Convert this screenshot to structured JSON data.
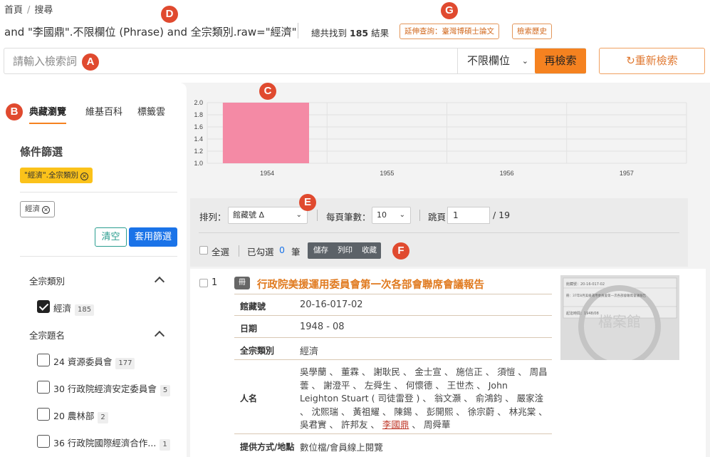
{
  "breadcrumb": {
    "home": "首頁",
    "current": "搜尋"
  },
  "query": {
    "text": "and \"李國鼎\".不限欄位 (Phrase) and 全宗類別.raw=\"經濟\"",
    "total_prefix": "總共找到",
    "total_count": "185",
    "total_suffix": "結果",
    "ext_button": "延伸查詢：臺灣博碩士論文",
    "history_button": "檢索歷史"
  },
  "search": {
    "placeholder": "請輸入檢索詞",
    "field_value": "不限欄位",
    "submit_label": "再檢索",
    "reset_label": "↻重新檢索"
  },
  "sidebar": {
    "tabs": [
      "典藏瀏覽",
      "維基百科",
      "標籤雲"
    ],
    "filter_title": "條件篩選",
    "active_tag": "\"經濟\".全宗類別",
    "keyword_tag": "經濟",
    "clear_label": "清空",
    "apply_label": "套用篩選",
    "facets": [
      {
        "title": "全宗類別",
        "items": [
          {
            "label": "經濟",
            "count": "185",
            "checked": true
          }
        ]
      },
      {
        "title": "全宗題名",
        "items": [
          {
            "label": "24 資源委員會",
            "count": "177",
            "checked": false
          },
          {
            "label": "30 行政院經濟安定委員會",
            "count": "5",
            "checked": false
          },
          {
            "label": "20 農林部",
            "count": "2",
            "checked": false
          },
          {
            "label": "36 行政院國際經濟合作...",
            "count": "1",
            "checked": false
          }
        ]
      }
    ]
  },
  "chart_data": {
    "type": "bar",
    "categories": [
      "1954",
      "1955",
      "1956",
      "1957"
    ],
    "values": [
      2.0,
      0,
      0,
      0
    ],
    "ylim": [
      1.0,
      2.0
    ],
    "yticks": [
      "2.0",
      "1.8",
      "1.6",
      "1.4",
      "1.2",
      "1.0"
    ],
    "bar_color": "#f48aa5",
    "grid": true
  },
  "toolbar": {
    "sort_label": "排列：",
    "sort_value": "館藏號 Δ",
    "per_page_label": "每頁筆數：",
    "per_page_value": "10",
    "jump_label": "跳頁",
    "page_value": "1",
    "total_pages": "/ 19",
    "select_all": "全選",
    "selected_label": "已勾選",
    "selected_count": "0",
    "selected_unit": "筆",
    "actions": [
      "儲存",
      "列印",
      "收藏"
    ]
  },
  "result": {
    "index": "1",
    "badge": "冊",
    "title": "行政院美援運用委員會第一次各部會聯席會議報告",
    "fields": [
      {
        "label": "館藏號",
        "value": "20-16-017-02"
      },
      {
        "label": "日期",
        "value": "1948 - 08"
      },
      {
        "label": "全宗類別",
        "value": "經濟"
      }
    ],
    "names_label": "人名",
    "names_before": "吳學蘭 、 董霖 、 謝耿民 、 金士宣 、 施信正 、 須愷 、 周昌蕓 、 謝澄平 、 左舜生 、 何懷德 、 王世杰 、 John Leighton Stuart ( 司徒雷登 ) 、 翁文灝 、 俞鴻鈞 、 嚴家淦 、 沈熙瑞 、 黃祖耀 、 陳錫 、 彭開熙 、 徐宗蔚 、 林兆棠 、 吳君實 、 許邦友 、",
    "names_highlight": "李國鼎",
    "names_after": " 、 周舜華",
    "access_label": "提供方式/地點",
    "access_value": "數位檔/會員線上閱覽",
    "thumb_lines": [
      "館藏號：20-16-017-02",
      "冊：37年8月美援運用委員會第一次各部會聯席會議報告",
      "起迄時間：1948/08"
    ],
    "thumb_watermark": "檔案館"
  },
  "markers": [
    "A",
    "B",
    "C",
    "D",
    "E",
    "F",
    "G"
  ]
}
